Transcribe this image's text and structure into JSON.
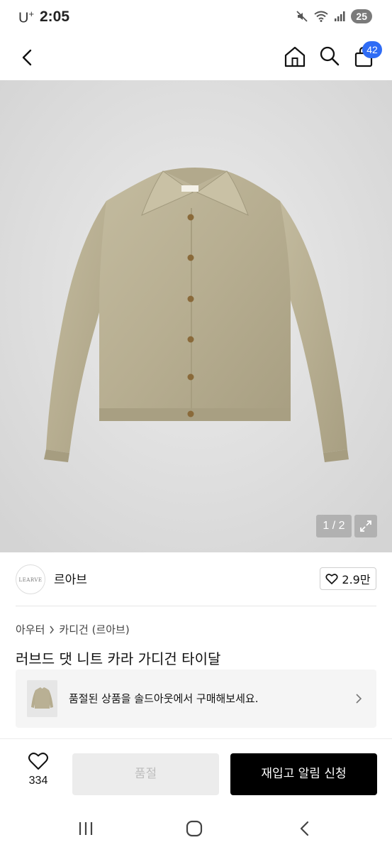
{
  "status_bar": {
    "carrier": "U",
    "carrier_sup": "+",
    "time": "2:05",
    "battery": "25"
  },
  "app_bar": {
    "icons": [
      "back-icon",
      "home-icon",
      "search-icon",
      "cart-icon"
    ],
    "cart_count": "42"
  },
  "gallery": {
    "counter": "1 / 2",
    "product_color": "#b9b094"
  },
  "brand": {
    "logo_text": "LEARVE",
    "name": "르아브",
    "likes": "2.9만"
  },
  "breadcrumb": {
    "category": "아우터",
    "subcategory": "카디건 (르아브)"
  },
  "product": {
    "title": "러브드 댓 니트 카라 가디건 타이달"
  },
  "soldout_banner": {
    "text": "품절된 상품을 솔드아웃에서 구매해보세요."
  },
  "bottom_bar": {
    "wish_count": "334",
    "soldout_label": "품절",
    "restock_label": "재입고 알림 신청"
  },
  "colors": {
    "accent": "#2f6cf5",
    "primary_button": "#000000",
    "disabled_button": "#ececec"
  }
}
